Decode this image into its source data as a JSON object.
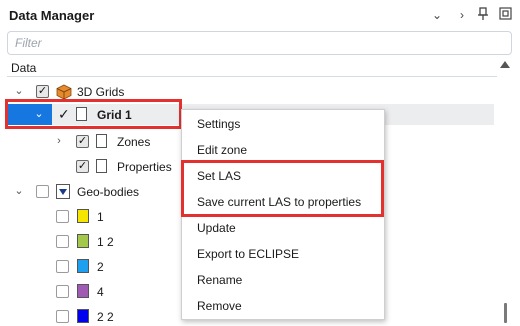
{
  "window": {
    "title": "Data Manager",
    "icons": [
      "chevron-down-icon",
      "chevron-right-icon",
      "pin-icon",
      "float-window-icon"
    ]
  },
  "filter": {
    "placeholder": "Filter",
    "value": ""
  },
  "tree": {
    "column_header": "Data",
    "items": [
      {
        "label": "3D Grids",
        "checked": true,
        "expanded": true
      },
      {
        "label": "Grid 1",
        "checked": true,
        "expanded": true,
        "selected": true
      },
      {
        "label": "Zones",
        "checked": true,
        "expanded": false
      },
      {
        "label": "Properties",
        "checked": true,
        "expanded": false
      },
      {
        "label": "Geo-bodies",
        "checked": false,
        "expanded": true
      },
      {
        "label": "1",
        "checked": false,
        "color": "#f5e600"
      },
      {
        "label": "1 2",
        "checked": false,
        "color": "#a4c84a"
      },
      {
        "label": "2",
        "checked": false,
        "color": "#1ea0f0"
      },
      {
        "label": "4",
        "checked": false,
        "color": "#a05cb4"
      },
      {
        "label": "2 2",
        "checked": false,
        "color": "#0000ee"
      }
    ]
  },
  "context_menu": {
    "items": [
      "Settings",
      "Edit zone",
      "Set LAS",
      "Save current LAS to properties",
      "Update",
      "Export to ECLIPSE",
      "Rename",
      "Remove"
    ]
  },
  "highlight_color": "#e2312f",
  "selection_color": "#1677e0"
}
